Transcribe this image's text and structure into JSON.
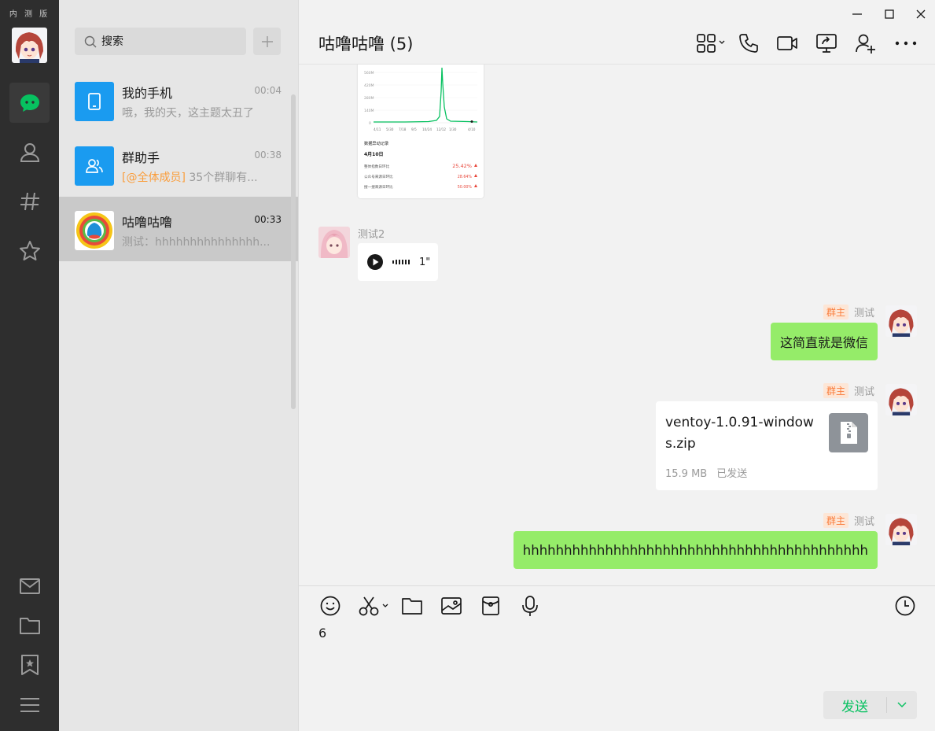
{
  "app": {
    "badge": "内 测 版"
  },
  "colors": {
    "accent": "#07c160",
    "bubble": "#95ec69",
    "owner_tag": "#fa7d3c"
  },
  "rail": {
    "items": [
      {
        "name": "chat-icon",
        "active": true
      },
      {
        "name": "contacts-icon"
      },
      {
        "name": "channels-icon"
      },
      {
        "name": "favorites-icon"
      }
    ],
    "bottom": [
      "mail-icon",
      "folder-icon",
      "bookmark-icon",
      "menu-icon"
    ]
  },
  "search": {
    "placeholder": "搜索"
  },
  "conversations": [
    {
      "name": "我的手机",
      "time": "00:04",
      "preview": "哦，我的天，这主题太丑了"
    },
    {
      "name": "群助手",
      "time": "00:38",
      "mention": "[@全体成员]",
      "preview": " 35个群聊有..."
    },
    {
      "name": "咕噜咕噜",
      "time": "00:33",
      "preview": "测试：hhhhhhhhhhhhhhh..."
    }
  ],
  "chat": {
    "title": "咕噜咕噜 (5)",
    "screenshot": {
      "ticks_y": [
        "560M",
        "420M",
        "280M",
        "140M",
        "0"
      ],
      "ticks_x": [
        "4/11",
        "5/30",
        "7/18",
        "9/5",
        "10/24",
        "12/12",
        "1/30",
        "4/10"
      ],
      "section": "数据异动记录",
      "date": "4月10日",
      "rows": [
        {
          "label": "整体指数日环比",
          "value": "25.42%"
        },
        {
          "label": "公众号来源日环比",
          "value": "28.64%"
        },
        {
          "label": "搜一搜来源日环比",
          "value": "50.00%"
        }
      ]
    },
    "voice_message": {
      "sender": "测试2",
      "duration": "1\""
    },
    "owner_tag": "群主",
    "my_name": "测试",
    "text_message": "这简直就是微信",
    "file": {
      "name": "ventoy-1.0.91-windows.zip",
      "size": "15.9 MB",
      "status": "已发送"
    },
    "long_message": "hhhhhhhhhhhhhhhhhhhhhhhhhhhhhhhhhhhhhhhhhh"
  },
  "composer": {
    "text": "6",
    "send_label": "发送"
  }
}
